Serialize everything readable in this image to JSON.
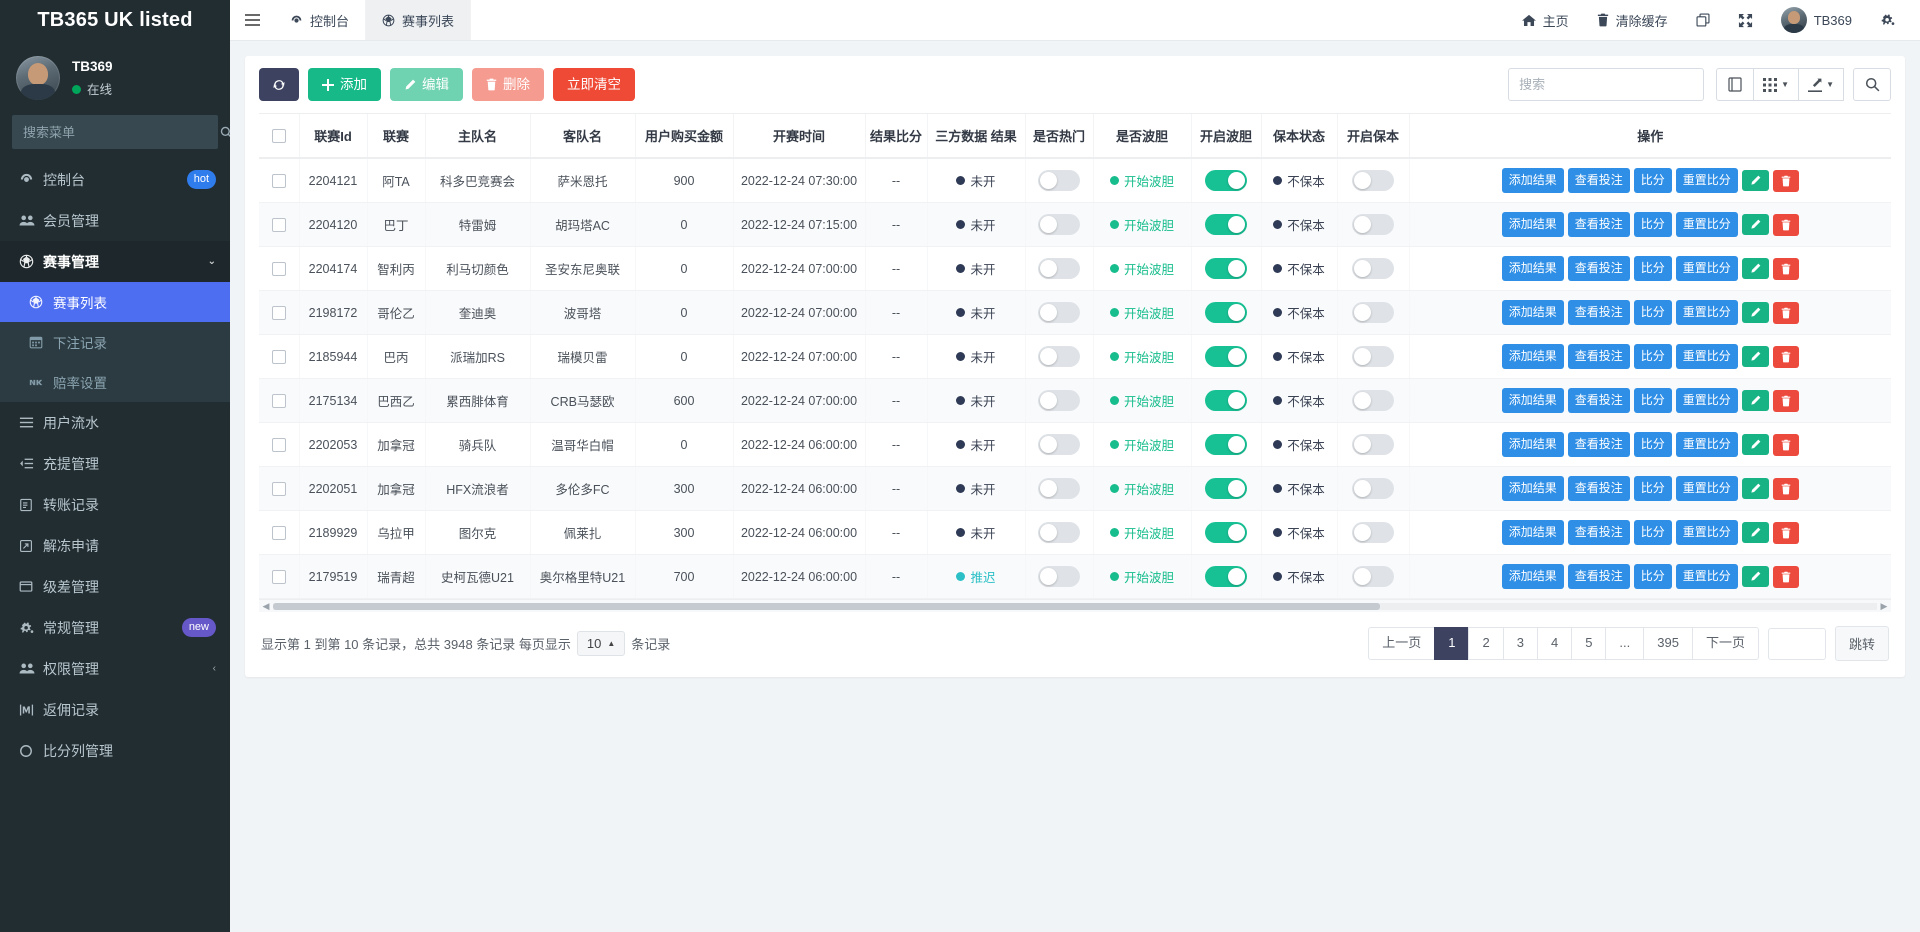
{
  "sidebar": {
    "brand": "TB365 UK listed",
    "user": {
      "name": "TB369",
      "status": "在线"
    },
    "search_placeholder": "搜索菜单",
    "items": [
      {
        "label": "控制台",
        "icon": "dashboard-icon",
        "badge": "hot",
        "badge_type": "hot"
      },
      {
        "label": "会员管理",
        "icon": "users-icon"
      },
      {
        "label": "赛事管理",
        "icon": "soccer-ball-icon",
        "expanded": true,
        "children": [
          {
            "label": "赛事列表",
            "icon": "soccer-ball-icon",
            "active": true
          },
          {
            "label": "下注记录",
            "icon": "calendar-icon"
          },
          {
            "label": "赔率设置",
            "icon": "vk-icon"
          }
        ]
      },
      {
        "label": "用户流水",
        "icon": "list-icon"
      },
      {
        "label": "充提管理",
        "icon": "indent-icon"
      },
      {
        "label": "转账记录",
        "icon": "transfer-icon"
      },
      {
        "label": "解冻申请",
        "icon": "unlock-share-icon"
      },
      {
        "label": "级差管理",
        "icon": "window-icon"
      },
      {
        "label": "常规管理",
        "icon": "cogs-icon",
        "badge": "new",
        "badge_type": "new"
      },
      {
        "label": "权限管理",
        "icon": "users-icon",
        "chevron": "‹"
      },
      {
        "label": "返佣记录",
        "icon": "rebate-icon"
      },
      {
        "label": "比分列管理",
        "icon": "circle-icon"
      }
    ]
  },
  "topbar": {
    "menu_icon": "hamburger-icon",
    "tabs": [
      {
        "label": "控制台",
        "icon": "dashboard-icon",
        "active": false
      },
      {
        "label": "赛事列表",
        "icon": "soccer-ball-icon",
        "active": true
      }
    ],
    "right_items": [
      {
        "label": "主页",
        "icon": "home-icon"
      },
      {
        "label": "清除缓存",
        "icon": "trash-icon"
      },
      {
        "label": "",
        "icon": "window-restore-icon"
      },
      {
        "label": "",
        "icon": "expand-arrows-icon"
      },
      {
        "label": "TB369",
        "icon": "avatar"
      },
      {
        "label": "",
        "icon": "gear-icon"
      }
    ]
  },
  "toolbar": {
    "refresh_icon": "refresh-icon",
    "add_label": "添加",
    "edit_label": "编辑",
    "delete_label": "删除",
    "clear_label": "立即清空",
    "search_placeholder": "搜索",
    "icons": [
      {
        "name": "book-icon",
        "glyph": "▤"
      },
      {
        "name": "columns-grid-icon",
        "glyph": "▦",
        "caret": "▼"
      },
      {
        "name": "export-icon",
        "glyph": "⬀",
        "caret": "▼"
      },
      {
        "name": "search-icon",
        "glyph": "⌕"
      }
    ]
  },
  "table": {
    "columns": [
      {
        "key": "checkbox",
        "label": ""
      },
      {
        "key": "league_id",
        "label": "联赛Id"
      },
      {
        "key": "league",
        "label": "联赛"
      },
      {
        "key": "home",
        "label": "主队名"
      },
      {
        "key": "away",
        "label": "客队名"
      },
      {
        "key": "amount",
        "label": "用户购买金额"
      },
      {
        "key": "start_time",
        "label": "开赛时间"
      },
      {
        "key": "result_score",
        "label": "结果比分"
      },
      {
        "key": "third_party",
        "label": "三方数据 结果"
      },
      {
        "key": "is_hot",
        "label": "是否热门"
      },
      {
        "key": "is_bodan",
        "label": "是否波胆"
      },
      {
        "key": "open_bodan",
        "label": "开启波胆"
      },
      {
        "key": "baoben_status",
        "label": "保本状态"
      },
      {
        "key": "open_baoben",
        "label": "开启保本"
      },
      {
        "key": "actions",
        "label": "操作"
      }
    ],
    "action_labels": {
      "add_result": "添加结果",
      "view_bets": "查看投注",
      "score": "比分",
      "reset_score": "重置比分",
      "edit_icon": "pencil-icon",
      "delete_icon": "trash-icon"
    },
    "rows": [
      {
        "league_id": "2204121",
        "league": "阿TA",
        "home": "科多巴竞赛会",
        "away": "萨米恩托",
        "amount": "900",
        "start_time": "2022-12-24 07:30:00",
        "result_score": "--",
        "third_party": "未开",
        "third_party_tone": "dark",
        "is_hot": false,
        "is_bodan": "开始波胆",
        "is_bodan_tone": "green",
        "open_bodan": true,
        "baoben_status": "不保本",
        "baoben_tone": "dark",
        "open_baoben": false
      },
      {
        "league_id": "2204120",
        "league": "巴丁",
        "home": "特雷姆",
        "away": "胡玛塔AC",
        "amount": "0",
        "start_time": "2022-12-24 07:15:00",
        "result_score": "--",
        "third_party": "未开",
        "third_party_tone": "dark",
        "is_hot": false,
        "is_bodan": "开始波胆",
        "is_bodan_tone": "green",
        "open_bodan": true,
        "baoben_status": "不保本",
        "baoben_tone": "dark",
        "open_baoben": false
      },
      {
        "league_id": "2204174",
        "league": "智利丙",
        "home": "利马切颜色",
        "away": "圣安东尼奥联",
        "amount": "0",
        "start_time": "2022-12-24 07:00:00",
        "result_score": "--",
        "third_party": "未开",
        "third_party_tone": "dark",
        "is_hot": false,
        "is_bodan": "开始波胆",
        "is_bodan_tone": "green",
        "open_bodan": true,
        "baoben_status": "不保本",
        "baoben_tone": "dark",
        "open_baoben": false
      },
      {
        "league_id": "2198172",
        "league": "哥伦乙",
        "home": "奎迪奥",
        "away": "波哥塔",
        "amount": "0",
        "start_time": "2022-12-24 07:00:00",
        "result_score": "--",
        "third_party": "未开",
        "third_party_tone": "dark",
        "is_hot": false,
        "is_bodan": "开始波胆",
        "is_bodan_tone": "green",
        "open_bodan": true,
        "baoben_status": "不保本",
        "baoben_tone": "dark",
        "open_baoben": false
      },
      {
        "league_id": "2185944",
        "league": "巴丙",
        "home": "派瑞加RS",
        "away": "瑞模贝雷",
        "amount": "0",
        "start_time": "2022-12-24 07:00:00",
        "result_score": "--",
        "third_party": "未开",
        "third_party_tone": "dark",
        "is_hot": false,
        "is_bodan": "开始波胆",
        "is_bodan_tone": "green",
        "open_bodan": true,
        "baoben_status": "不保本",
        "baoben_tone": "dark",
        "open_baoben": false
      },
      {
        "league_id": "2175134",
        "league": "巴西乙",
        "home": "累西腓体育",
        "away": "CRB马瑟欧",
        "amount": "600",
        "start_time": "2022-12-24 07:00:00",
        "result_score": "--",
        "third_party": "未开",
        "third_party_tone": "dark",
        "is_hot": false,
        "is_bodan": "开始波胆",
        "is_bodan_tone": "green",
        "open_bodan": true,
        "baoben_status": "不保本",
        "baoben_tone": "dark",
        "open_baoben": false
      },
      {
        "league_id": "2202053",
        "league": "加拿冠",
        "home": "骑兵队",
        "away": "温哥华白帽",
        "amount": "0",
        "start_time": "2022-12-24 06:00:00",
        "result_score": "--",
        "third_party": "未开",
        "third_party_tone": "dark",
        "is_hot": false,
        "is_bodan": "开始波胆",
        "is_bodan_tone": "green",
        "open_bodan": true,
        "baoben_status": "不保本",
        "baoben_tone": "dark",
        "open_baoben": false
      },
      {
        "league_id": "2202051",
        "league": "加拿冠",
        "home": "HFX流浪者",
        "away": "多伦多FC",
        "amount": "300",
        "start_time": "2022-12-24 06:00:00",
        "result_score": "--",
        "third_party": "未开",
        "third_party_tone": "dark",
        "is_hot": false,
        "is_bodan": "开始波胆",
        "is_bodan_tone": "green",
        "open_bodan": true,
        "baoben_status": "不保本",
        "baoben_tone": "dark",
        "open_baoben": false
      },
      {
        "league_id": "2189929",
        "league": "乌拉甲",
        "home": "图尔克",
        "away": "佩莱扎",
        "amount": "300",
        "start_time": "2022-12-24 06:00:00",
        "result_score": "--",
        "third_party": "未开",
        "third_party_tone": "dark",
        "is_hot": false,
        "is_bodan": "开始波胆",
        "is_bodan_tone": "green",
        "open_bodan": true,
        "baoben_status": "不保本",
        "baoben_tone": "dark",
        "open_baoben": false
      },
      {
        "league_id": "2179519",
        "league": "瑞青超",
        "home": "史柯瓦德U21",
        "away": "奥尔格里特U21",
        "amount": "700",
        "start_time": "2022-12-24 06:00:00",
        "result_score": "--",
        "third_party": "推迟",
        "third_party_tone": "teal",
        "is_hot": false,
        "is_bodan": "开始波胆",
        "is_bodan_tone": "green",
        "open_bodan": true,
        "baoben_status": "不保本",
        "baoben_tone": "dark",
        "open_baoben": false
      }
    ]
  },
  "footer": {
    "info_prefix": "显示第 1 到第 10 条记录，总共 3948 条记录 每页显示",
    "page_size": "10",
    "info_suffix": "条记录",
    "prev_label": "上一页",
    "next_label": "下一页",
    "pages": [
      "1",
      "2",
      "3",
      "4",
      "5",
      "...",
      "395"
    ],
    "active_page": "1",
    "jump_label": "跳转",
    "jump_value": ""
  },
  "colors": {
    "sidebar_bg": "#222d32",
    "accent_blue": "#4e6ef2",
    "green": "#17c194",
    "red": "#ef4a36",
    "action_blue": "#2f8fe6"
  }
}
